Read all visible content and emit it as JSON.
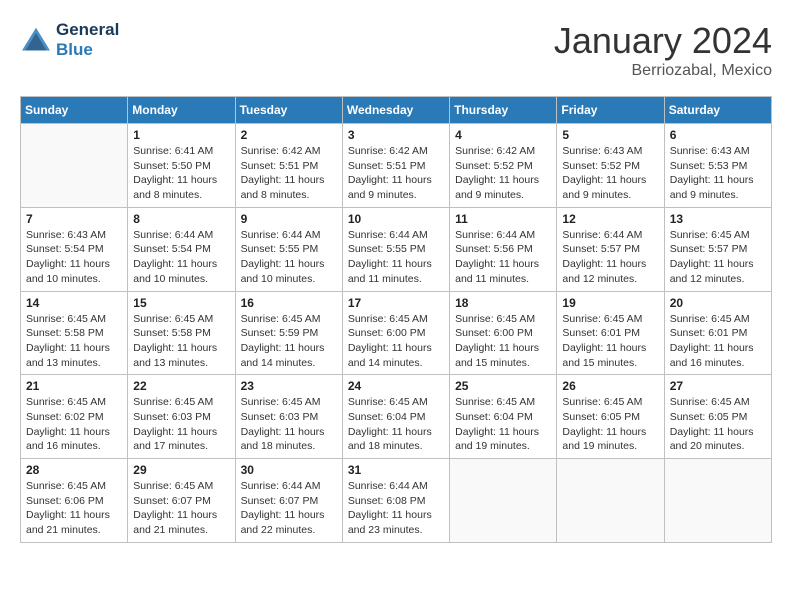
{
  "header": {
    "logo_line1": "General",
    "logo_line2": "Blue",
    "month_title": "January 2024",
    "location": "Berriozabal, Mexico"
  },
  "weekdays": [
    "Sunday",
    "Monday",
    "Tuesday",
    "Wednesday",
    "Thursday",
    "Friday",
    "Saturday"
  ],
  "weeks": [
    [
      {
        "day": "",
        "sunrise": "",
        "sunset": "",
        "daylight": ""
      },
      {
        "day": "1",
        "sunrise": "Sunrise: 6:41 AM",
        "sunset": "Sunset: 5:50 PM",
        "daylight": "Daylight: 11 hours and 8 minutes."
      },
      {
        "day": "2",
        "sunrise": "Sunrise: 6:42 AM",
        "sunset": "Sunset: 5:51 PM",
        "daylight": "Daylight: 11 hours and 8 minutes."
      },
      {
        "day": "3",
        "sunrise": "Sunrise: 6:42 AM",
        "sunset": "Sunset: 5:51 PM",
        "daylight": "Daylight: 11 hours and 9 minutes."
      },
      {
        "day": "4",
        "sunrise": "Sunrise: 6:42 AM",
        "sunset": "Sunset: 5:52 PM",
        "daylight": "Daylight: 11 hours and 9 minutes."
      },
      {
        "day": "5",
        "sunrise": "Sunrise: 6:43 AM",
        "sunset": "Sunset: 5:52 PM",
        "daylight": "Daylight: 11 hours and 9 minutes."
      },
      {
        "day": "6",
        "sunrise": "Sunrise: 6:43 AM",
        "sunset": "Sunset: 5:53 PM",
        "daylight": "Daylight: 11 hours and 9 minutes."
      }
    ],
    [
      {
        "day": "7",
        "sunrise": "Sunrise: 6:43 AM",
        "sunset": "Sunset: 5:54 PM",
        "daylight": "Daylight: 11 hours and 10 minutes."
      },
      {
        "day": "8",
        "sunrise": "Sunrise: 6:44 AM",
        "sunset": "Sunset: 5:54 PM",
        "daylight": "Daylight: 11 hours and 10 minutes."
      },
      {
        "day": "9",
        "sunrise": "Sunrise: 6:44 AM",
        "sunset": "Sunset: 5:55 PM",
        "daylight": "Daylight: 11 hours and 10 minutes."
      },
      {
        "day": "10",
        "sunrise": "Sunrise: 6:44 AM",
        "sunset": "Sunset: 5:55 PM",
        "daylight": "Daylight: 11 hours and 11 minutes."
      },
      {
        "day": "11",
        "sunrise": "Sunrise: 6:44 AM",
        "sunset": "Sunset: 5:56 PM",
        "daylight": "Daylight: 11 hours and 11 minutes."
      },
      {
        "day": "12",
        "sunrise": "Sunrise: 6:44 AM",
        "sunset": "Sunset: 5:57 PM",
        "daylight": "Daylight: 11 hours and 12 minutes."
      },
      {
        "day": "13",
        "sunrise": "Sunrise: 6:45 AM",
        "sunset": "Sunset: 5:57 PM",
        "daylight": "Daylight: 11 hours and 12 minutes."
      }
    ],
    [
      {
        "day": "14",
        "sunrise": "Sunrise: 6:45 AM",
        "sunset": "Sunset: 5:58 PM",
        "daylight": "Daylight: 11 hours and 13 minutes."
      },
      {
        "day": "15",
        "sunrise": "Sunrise: 6:45 AM",
        "sunset": "Sunset: 5:58 PM",
        "daylight": "Daylight: 11 hours and 13 minutes."
      },
      {
        "day": "16",
        "sunrise": "Sunrise: 6:45 AM",
        "sunset": "Sunset: 5:59 PM",
        "daylight": "Daylight: 11 hours and 14 minutes."
      },
      {
        "day": "17",
        "sunrise": "Sunrise: 6:45 AM",
        "sunset": "Sunset: 6:00 PM",
        "daylight": "Daylight: 11 hours and 14 minutes."
      },
      {
        "day": "18",
        "sunrise": "Sunrise: 6:45 AM",
        "sunset": "Sunset: 6:00 PM",
        "daylight": "Daylight: 11 hours and 15 minutes."
      },
      {
        "day": "19",
        "sunrise": "Sunrise: 6:45 AM",
        "sunset": "Sunset: 6:01 PM",
        "daylight": "Daylight: 11 hours and 15 minutes."
      },
      {
        "day": "20",
        "sunrise": "Sunrise: 6:45 AM",
        "sunset": "Sunset: 6:01 PM",
        "daylight": "Daylight: 11 hours and 16 minutes."
      }
    ],
    [
      {
        "day": "21",
        "sunrise": "Sunrise: 6:45 AM",
        "sunset": "Sunset: 6:02 PM",
        "daylight": "Daylight: 11 hours and 16 minutes."
      },
      {
        "day": "22",
        "sunrise": "Sunrise: 6:45 AM",
        "sunset": "Sunset: 6:03 PM",
        "daylight": "Daylight: 11 hours and 17 minutes."
      },
      {
        "day": "23",
        "sunrise": "Sunrise: 6:45 AM",
        "sunset": "Sunset: 6:03 PM",
        "daylight": "Daylight: 11 hours and 18 minutes."
      },
      {
        "day": "24",
        "sunrise": "Sunrise: 6:45 AM",
        "sunset": "Sunset: 6:04 PM",
        "daylight": "Daylight: 11 hours and 18 minutes."
      },
      {
        "day": "25",
        "sunrise": "Sunrise: 6:45 AM",
        "sunset": "Sunset: 6:04 PM",
        "daylight": "Daylight: 11 hours and 19 minutes."
      },
      {
        "day": "26",
        "sunrise": "Sunrise: 6:45 AM",
        "sunset": "Sunset: 6:05 PM",
        "daylight": "Daylight: 11 hours and 19 minutes."
      },
      {
        "day": "27",
        "sunrise": "Sunrise: 6:45 AM",
        "sunset": "Sunset: 6:05 PM",
        "daylight": "Daylight: 11 hours and 20 minutes."
      }
    ],
    [
      {
        "day": "28",
        "sunrise": "Sunrise: 6:45 AM",
        "sunset": "Sunset: 6:06 PM",
        "daylight": "Daylight: 11 hours and 21 minutes."
      },
      {
        "day": "29",
        "sunrise": "Sunrise: 6:45 AM",
        "sunset": "Sunset: 6:07 PM",
        "daylight": "Daylight: 11 hours and 21 minutes."
      },
      {
        "day": "30",
        "sunrise": "Sunrise: 6:44 AM",
        "sunset": "Sunset: 6:07 PM",
        "daylight": "Daylight: 11 hours and 22 minutes."
      },
      {
        "day": "31",
        "sunrise": "Sunrise: 6:44 AM",
        "sunset": "Sunset: 6:08 PM",
        "daylight": "Daylight: 11 hours and 23 minutes."
      },
      {
        "day": "",
        "sunrise": "",
        "sunset": "",
        "daylight": ""
      },
      {
        "day": "",
        "sunrise": "",
        "sunset": "",
        "daylight": ""
      },
      {
        "day": "",
        "sunrise": "",
        "sunset": "",
        "daylight": ""
      }
    ]
  ]
}
